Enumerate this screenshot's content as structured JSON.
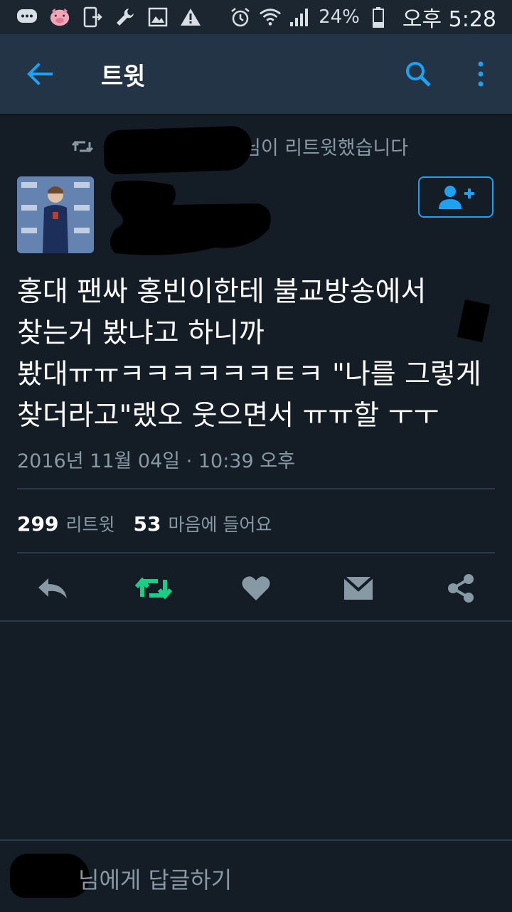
{
  "status_bar": {
    "battery_percent": "24%",
    "time": "오후 5:28",
    "icons": [
      "chat-bubble-icon",
      "pig-icon",
      "phone-transfer-icon",
      "wrench-icon",
      "image-icon",
      "warning-icon",
      "alarm-icon",
      "wifi-icon",
      "signal-icon",
      "battery-icon"
    ]
  },
  "app_bar": {
    "title": "트윗"
  },
  "retweet_banner": {
    "text": "님이 리트윗했습니다"
  },
  "tweet": {
    "text": "홍대 팬싸 홍빈이한테 불교방송에서\n찾는거 봤냐고 하니까\n봤대ㅠㅠㅋㅋㅋㅋㅋㅋㅌㅋ \"나를 그렇게\n찾더라고\"랬오 웃으면서 ㅠㅠ할 ㅜㅜ",
    "timestamp": "2016년 11월 04일 · 10:39 오후"
  },
  "stats": {
    "retweets_count": "299",
    "retweets_label": "리트윗",
    "likes_count": "53",
    "likes_label": "마음에 들어요"
  },
  "reply": {
    "placeholder": "님에게 답글하기"
  },
  "colors": {
    "background": "#141d26",
    "app_bar": "#243447",
    "accent": "#1da1f2",
    "retweet_green": "#19cf86",
    "muted": "#8899a6"
  }
}
